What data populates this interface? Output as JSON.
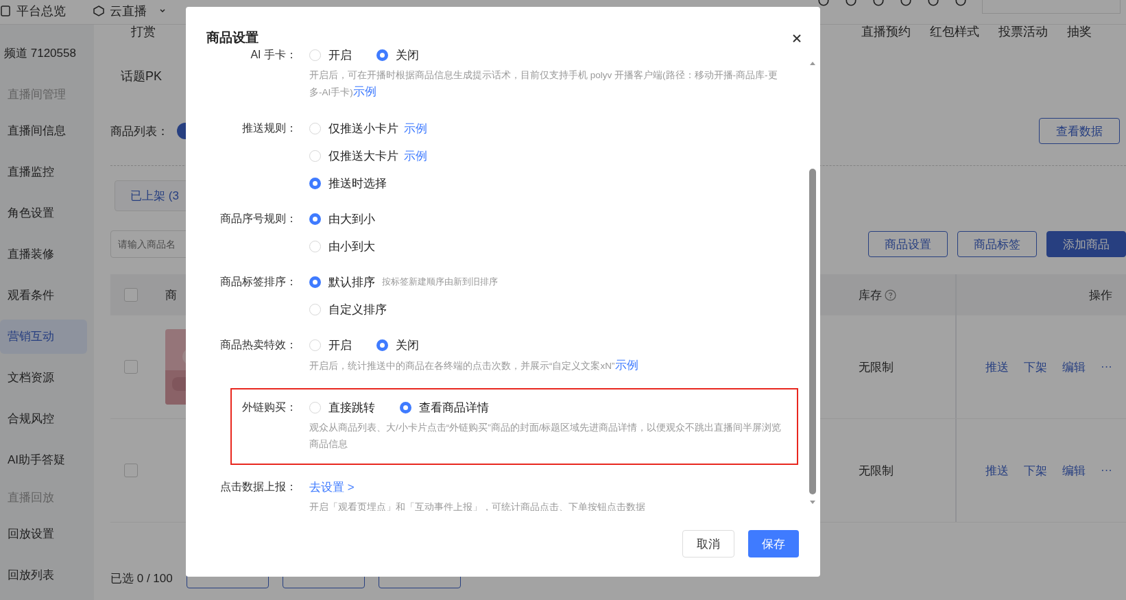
{
  "top_nav": [
    {
      "label": "平台总览"
    },
    {
      "label": "云直播"
    }
  ],
  "sidebar": {
    "channel": "频道 7120558",
    "groups": [
      {
        "title": "直播间管理",
        "items": [
          {
            "label": "直播间信息",
            "selected": false
          },
          {
            "label": "直播监控",
            "selected": false
          },
          {
            "label": "角色设置",
            "selected": false
          },
          {
            "label": "直播装修",
            "selected": false
          },
          {
            "label": "观看条件",
            "selected": false
          },
          {
            "label": "营销互动",
            "selected": true
          },
          {
            "label": "文档资源",
            "selected": false
          },
          {
            "label": "合规风控",
            "selected": false
          },
          {
            "label": "AI助手答疑",
            "selected": false
          }
        ]
      },
      {
        "title": "直播回放",
        "items": [
          {
            "label": "回放设置",
            "selected": false
          },
          {
            "label": "回放列表",
            "selected": false
          }
        ]
      }
    ]
  },
  "feature_tabs": {
    "left": [
      "打赏",
      "话题PK"
    ],
    "right": [
      "直播预约",
      "红包样式",
      "投票活动",
      "抽奖"
    ]
  },
  "product_list": {
    "label": "商品列表：",
    "switch_on": true,
    "view_data_button": "查看数据"
  },
  "status_tab": {
    "label": "已上架 (3",
    "selected": true
  },
  "search": {
    "placeholder": "请输入商品名"
  },
  "toolbar_buttons": [
    {
      "label": "商品设置",
      "kind": "outline"
    },
    {
      "label": "商品标签",
      "kind": "outline"
    },
    {
      "label": "添加商品",
      "kind": "primary"
    }
  ],
  "table": {
    "columns": [
      "商",
      "库存",
      "操作"
    ],
    "rows": [
      {
        "kind": "picture",
        "checked": false,
        "stock": "无限制",
        "actions": [
          "推送",
          "下架",
          "编辑",
          "···"
        ]
      },
      {
        "kind": "text",
        "checked": false,
        "stock": "无限制",
        "actions": [
          "推送",
          "下架",
          "编辑",
          "···"
        ]
      }
    ],
    "all_checked": false
  },
  "selection": "已选 0 / 100",
  "modal": {
    "title": "商品设置",
    "fields": [
      {
        "kind": "inline_radio",
        "label": "AI 手卡：",
        "options": [
          {
            "label": "开启",
            "selected": false
          },
          {
            "label": "关闭",
            "selected": true
          }
        ],
        "hint": "开启后，可在开播时根据商品信息生成提示话术，目前仅支持手机 polyv 开播客户端(路径：移动开播-商品库-更多-AI手卡)",
        "hint_link": "示例"
      },
      {
        "kind": "stacked_radio",
        "label": "推送规则：",
        "options": [
          {
            "label": "仅推送小卡片",
            "selected": false,
            "link": "示例"
          },
          {
            "label": "仅推送大卡片",
            "selected": false,
            "link": "示例"
          },
          {
            "label": "推送时选择",
            "selected": true
          }
        ]
      },
      {
        "kind": "stacked_radio",
        "label": "商品序号规则：",
        "options": [
          {
            "label": "由大到小",
            "selected": true
          },
          {
            "label": "由小到大",
            "selected": false
          }
        ]
      },
      {
        "kind": "stacked_radio",
        "label": "商品标签排序：",
        "options": [
          {
            "label": "默认排序",
            "selected": true,
            "note": "按标签新建顺序由新到旧排序"
          },
          {
            "label": "自定义排序",
            "selected": false
          }
        ]
      },
      {
        "kind": "inline_radio",
        "label": "商品热卖特效：",
        "options": [
          {
            "label": "开启",
            "selected": false
          },
          {
            "label": "关闭",
            "selected": true
          }
        ],
        "hint": "开启后，统计推送中的商品在各终端的点击次数，并展示“自定义文案xN”",
        "hint_link": "示例"
      },
      {
        "kind": "inline_radio",
        "label": "外链购买：",
        "highlighted": true,
        "options": [
          {
            "label": "直接跳转",
            "selected": false
          },
          {
            "label": "查看商品详情",
            "selected": true
          }
        ],
        "hint": "观众从商品列表、大/小卡片点击“外链购买”商品的封面/标题区域先进商品详情，以便观众不跳出直播间半屏浏览商品信息"
      },
      {
        "kind": "link",
        "label": "点击数据上报：",
        "link": "去设置 >",
        "hint": "开启「观看页埋点」和「互动事件上报」，可统计商品点击、下单按钮点击数据"
      }
    ],
    "buttons": [
      {
        "label": "取消",
        "kind": "default"
      },
      {
        "label": "保存",
        "kind": "primary"
      }
    ]
  }
}
